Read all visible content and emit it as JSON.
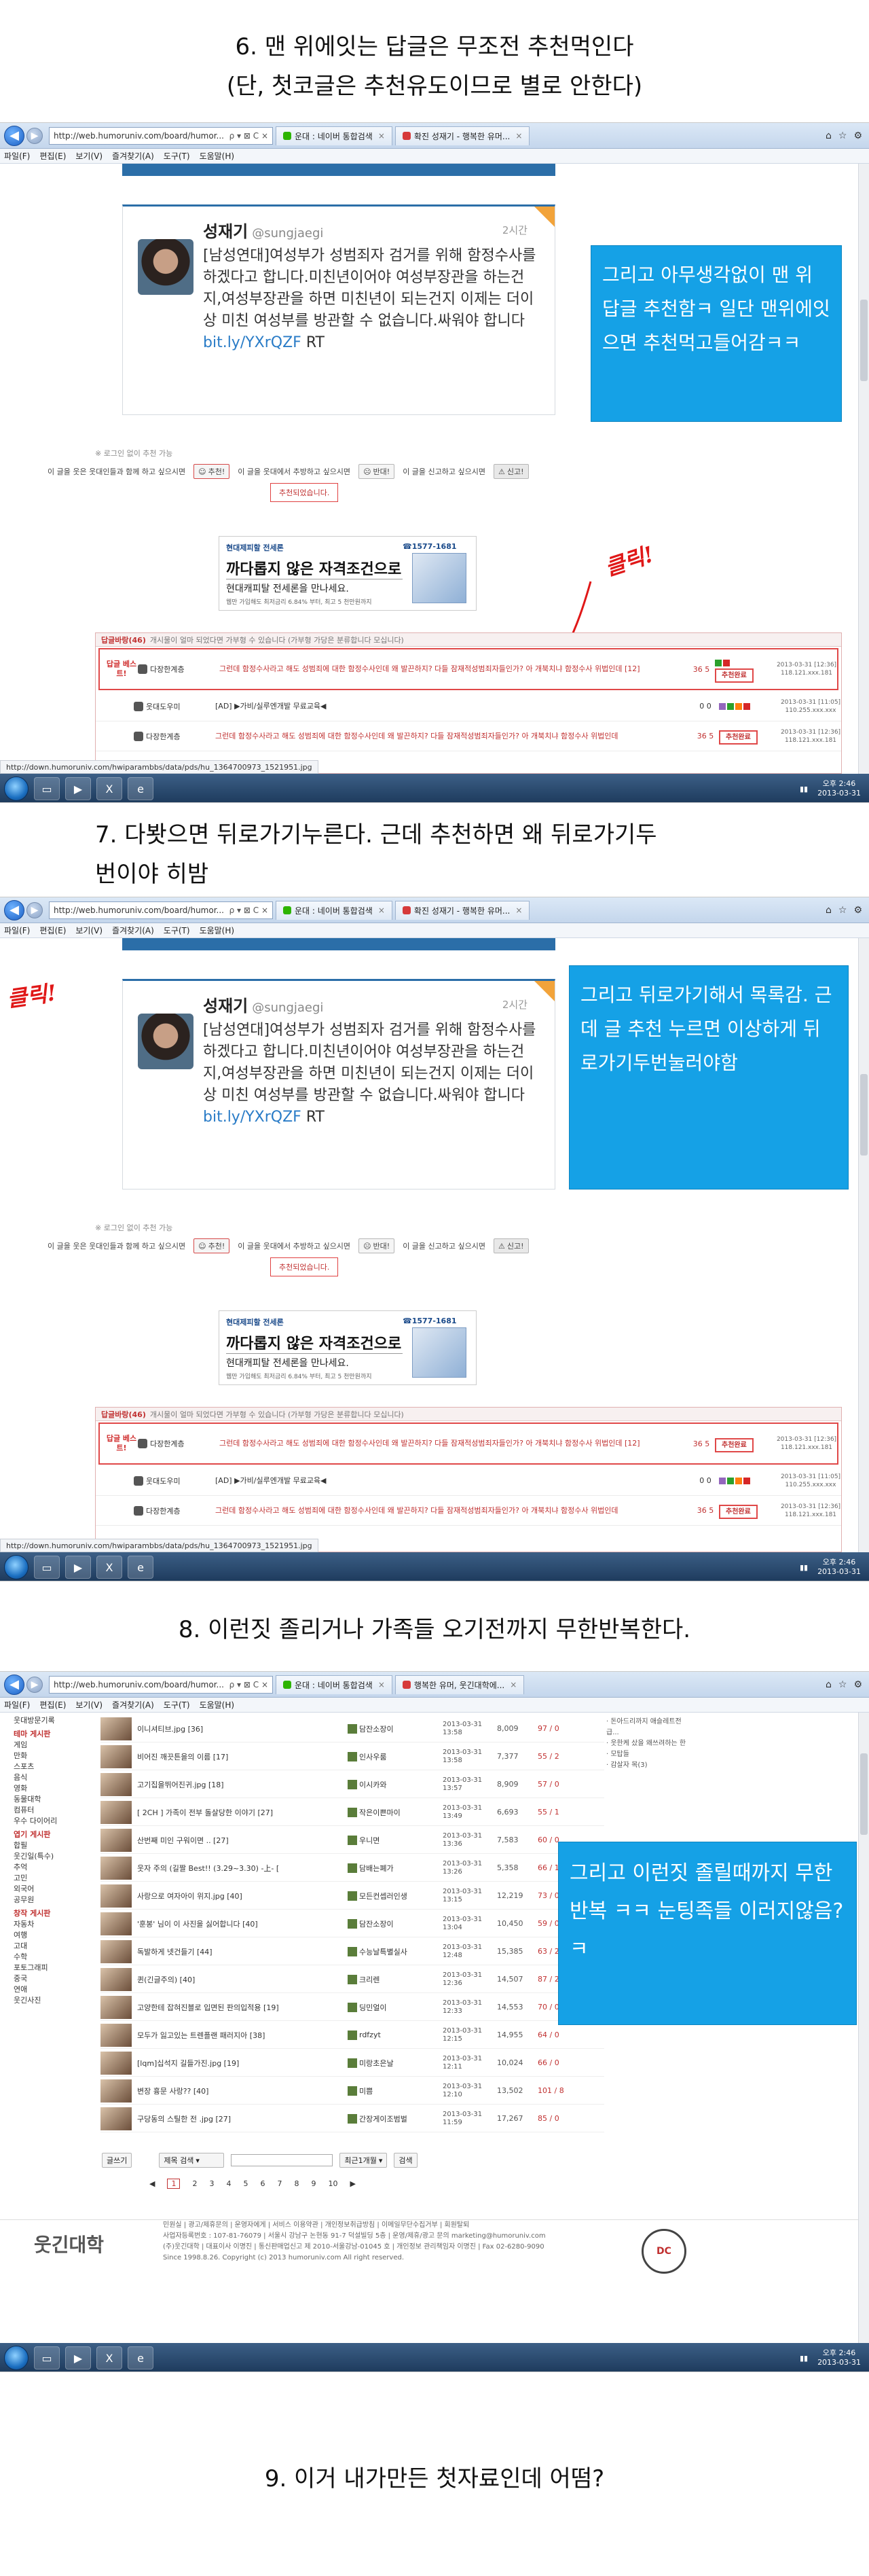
{
  "captions": {
    "c6_line1": "6. 맨 위에잇는 답글은 무조전 추천먹인다",
    "c6_line2": "(단, 첫코글은 추천유도이므로 별로 안한다)",
    "c7_line1": "7. 다봣으면 뒤로가기누른다. 근데 추천하면 왜 뒤로가기두",
    "c7_line2": "번이야 히밤",
    "c8": "8. 이런짓 졸리거나 가족들 오기전까지 무한반복한다.",
    "c9": "9. 이거 내가만든 첫자료인데 어떰?"
  },
  "browser": {
    "address": "http://web.humoruniv.com/board/humor...",
    "address_ctrl": "ρ ▾ ⊠ C ×",
    "tab1": "운대 : 네이버 통합검색",
    "tab2": "확진 성재기 - 행복한 유머...",
    "tab2_alt": "행복한 유머, 웃긴대학에...",
    "menu": [
      "파일(F)",
      "편집(E)",
      "보기(V)",
      "즐겨찾기(A)",
      "도구(T)",
      "도움말(H)"
    ]
  },
  "tweet": {
    "name": "성재기",
    "handle": "@sungjaegi",
    "time": "2시간",
    "body": "[남성연대]여성부가 성범죄자 검거를 위해 함정수사를 하겠다고 합니다.미친년이어야 여성부장관을 하는건지,여성부장관을 하면 미친년이 되는건지 이제는 더이상 미친 여성부를 방관할 수 없습니다.싸워야 합니다",
    "link": "bit.ly/YXrQZF",
    "suffix": " RT"
  },
  "notes": {
    "n1": "그리고 아무생각없이 맨 위 답글 추천함ㅋ 일단 맨위에잇으면 추천먹고들어감ㅋㅋ",
    "n2": "그리고 뒤로가기해서 목록감. 근데 글 추천 누르면 이상하게 뒤로가기두번눌러야함",
    "n3": "그리고 이런짓 졸릴때까지 무한반복 ㅋㅋ 눈팅족들 이러지않음?ㅋ"
  },
  "handwriting": {
    "click1": "클릭!",
    "click2": "클릭!"
  },
  "reco": {
    "tip": "※ 로그인 없이 추천 가능",
    "q1": "이 글을 웃은 웃대인들과 함께 하고 싶으시면",
    "btn_up": "추천!",
    "q2": "이 글을 웃대에서 추방하고 싶으시면",
    "btn_down": "반대!",
    "q3": "이 글을 신고하고 싶으시면",
    "btn_report": "신고!",
    "done": "추천되었습니다."
  },
  "ad": {
    "brand": "현대제피할 전세론",
    "phone": "☎1577-1681",
    "head": "까다롭지 않은 자격조건으로",
    "sub": "현대캐피탈 전세론을 만나세요.",
    "tiny": "웹만 가입해도 최저금리 6.84% 부터, 최고 5 천만원까지"
  },
  "comments": {
    "header": "답글바랑(46)",
    "header_note": "개시물이 얼마 되었다면 가부형 수 있습니다 (가부형 가당은 분류합니다 모십니다)",
    "best_label": "답글 베스트!",
    "rows": [
      {
        "nick": "다장한계층",
        "text": "그런데 함정수사라고 해도 성범죄에 대한 함정수사인데 왜 발끈하지? 다들 잠재적성범죄자들인가? 아 개북치냐 함정수사 위법인데 [12]",
        "score": "36 5",
        "meta": "2013-03-31 [12:36] 118.121.xxx.181"
      },
      {
        "nick": "웃대도우미",
        "text": "[AD] ▶가비/실루엔개발 무료교육◀",
        "score": "0 0",
        "meta": "2013-03-31 [11:05] 110.255.xxx.xxx"
      },
      {
        "nick": "다장한계층",
        "text": "그런데 함정수사라고 해도 성범죄에 대한 함정수사인데 왜 발끈하지? 다들 잠재적성범죄자들인가? 아 개북치냐 함정수사 위법인데",
        "score": "36 5",
        "meta": "2013-03-31 [12:36] 118.121.xxx.181"
      }
    ],
    "rec_btn": "추천완료"
  },
  "status_url": "http://down.humoruniv.com/hwiparambbs/data/pds/hu_1364700973_1521951.jpg",
  "clock": {
    "time": "오후 2:46",
    "date": "2013-03-31"
  },
  "clock2": {
    "time": "오후 2:46",
    "date": "2013-03-31"
  },
  "list": {
    "side": [
      "웃대방문기록",
      "테마 게시판",
      "게임",
      "만화",
      "스포츠",
      "음식",
      "영화",
      "동물대학",
      "컴퓨터",
      "우수 다이어리",
      "엽기 게시판",
      "합필",
      "웃긴일(특수)",
      "추억",
      "고민",
      "외국어",
      "공무원",
      "창작 게시판",
      "자동차",
      "여행",
      "고대",
      "수학",
      "포토그래피",
      "중국",
      "연애",
      "웃긴사진"
    ],
    "rows": [
      {
        "title": "이니셔티브.jpg [36]",
        "auth": "담잔소장이",
        "date": "2013-03-31 13:58",
        "hits": "8,009",
        "rec": "97 / 0"
      },
      {
        "title": "비어진 깨끗튼을의 이름 [17]",
        "auth": "인사우룸",
        "date": "2013-03-31 13:58",
        "hits": "7,377",
        "rec": "55 / 2"
      },
      {
        "title": "고기집을뛰어진귀.jpg [18]",
        "auth": "이시카와",
        "date": "2013-03-31 13:57",
        "hits": "8,909",
        "rec": "57 / 0"
      },
      {
        "title": "[ 2CH ] 가족이 전부 돌살당한 이야기 [27]",
        "auth": "작은이쁜마이",
        "date": "2013-03-31 13:49",
        "hits": "6,693",
        "rec": "55 / 1"
      },
      {
        "title": "산번째 미인 구워이면 .. [27]",
        "auth": "우니면",
        "date": "2013-03-31 13:36",
        "hits": "7,583",
        "rec": "60 / 0"
      },
      {
        "title": "웃자 주의 (길짤 Best!! (3.29~3.30) -上- [32]",
        "auth": "담배는폐가",
        "date": "2013-03-31 13:26",
        "hits": "5,358",
        "rec": "66 / 1"
      },
      {
        "title": "사랑으로 여자아이 위지.jpg [40]",
        "auth": "모든컨셉러인생",
        "date": "2013-03-31 13:15",
        "hits": "12,219",
        "rec": "73 / 0"
      },
      {
        "title": "'훈봉' 님이 이 사진을 싫어합니다 [40]",
        "auth": "담잔소장이",
        "date": "2013-03-31 13:04",
        "hits": "10,450",
        "rec": "59 / 0"
      },
      {
        "title": "독발하게 넷건들기 [44]",
        "auth": "수능날특별실사",
        "date": "2013-03-31 12:48",
        "hits": "15,385",
        "rec": "63 / 2"
      },
      {
        "title": "퀸(긴글주의) [40]",
        "auth": "크리렌",
        "date": "2013-03-31 12:36",
        "hits": "14,507",
        "rec": "87 / 2"
      },
      {
        "title": "고양한테 잡혀진블로 입면된 판의입적용 [19]",
        "auth": "딩민얼이",
        "date": "2013-03-31 12:33",
        "hits": "14,553",
        "rec": "70 / 0"
      },
      {
        "title": "모두가 잃고있는 트렌플랜 패러지아 [38]",
        "auth": "rdfzyt",
        "date": "2013-03-31 12:15",
        "hits": "14,955",
        "rec": "64 / 0"
      },
      {
        "title": "[lqm]십석지 길들가진.jpg [19]",
        "auth": "미랑초은날",
        "date": "2013-03-31 12:11",
        "hits": "10,024",
        "rec": "66 / 0"
      },
      {
        "title": "변장 흉문 사랑?? [40]",
        "auth": "미쁨",
        "date": "2013-03-31 12:10",
        "hits": "13,502",
        "rec": "101 / 8"
      },
      {
        "title": "구당동의 스틸한 전 .jpg [27]",
        "auth": "간장게이조범벌",
        "date": "2013-03-31 11:59",
        "hits": "17,267",
        "rec": "85 / 0"
      }
    ],
    "right": [
      "· 돈아드리까지 애슬레트전급...",
      "· 웃한케 샀을 왜쓰려하는 한",
      "· 모탑들",
      "· 감살자 목(3)"
    ],
    "search_btn": "검색",
    "search_select": "제목 검색",
    "period_select": "최근1개월",
    "go_btn": "글쓰기",
    "pages": [
      "1",
      "2",
      "3",
      "4",
      "5",
      "6",
      "7",
      "8",
      "9",
      "10"
    ],
    "footer1": "민원실 | 광고/제휴문의 | 운영자에게 | 서비스 이용약관 | 개인정보취급방침 | 이메일무단수집거부 | 회원탈퇴",
    "footer2": "사업자등록번호 : 107-81-76079 | 서울시 강남구 논현동 91-7 덕설빌딩 5층 | 운영/제휴/광고 문의 marketing@humoruniv.com",
    "footer3": "(주)웃긴대학 | 대표이사 이명진 | 통신판매업신고 제 2010-서울강남-01045 호 | 개인정보 관리책임자 이명진 | Fax 02-6280-9090",
    "footer4": "Since 1998.8.26. Copyright (c) 2013 humoruniv.com All right reserved.",
    "logo": "웃긴대학",
    "badge": "DC"
  }
}
